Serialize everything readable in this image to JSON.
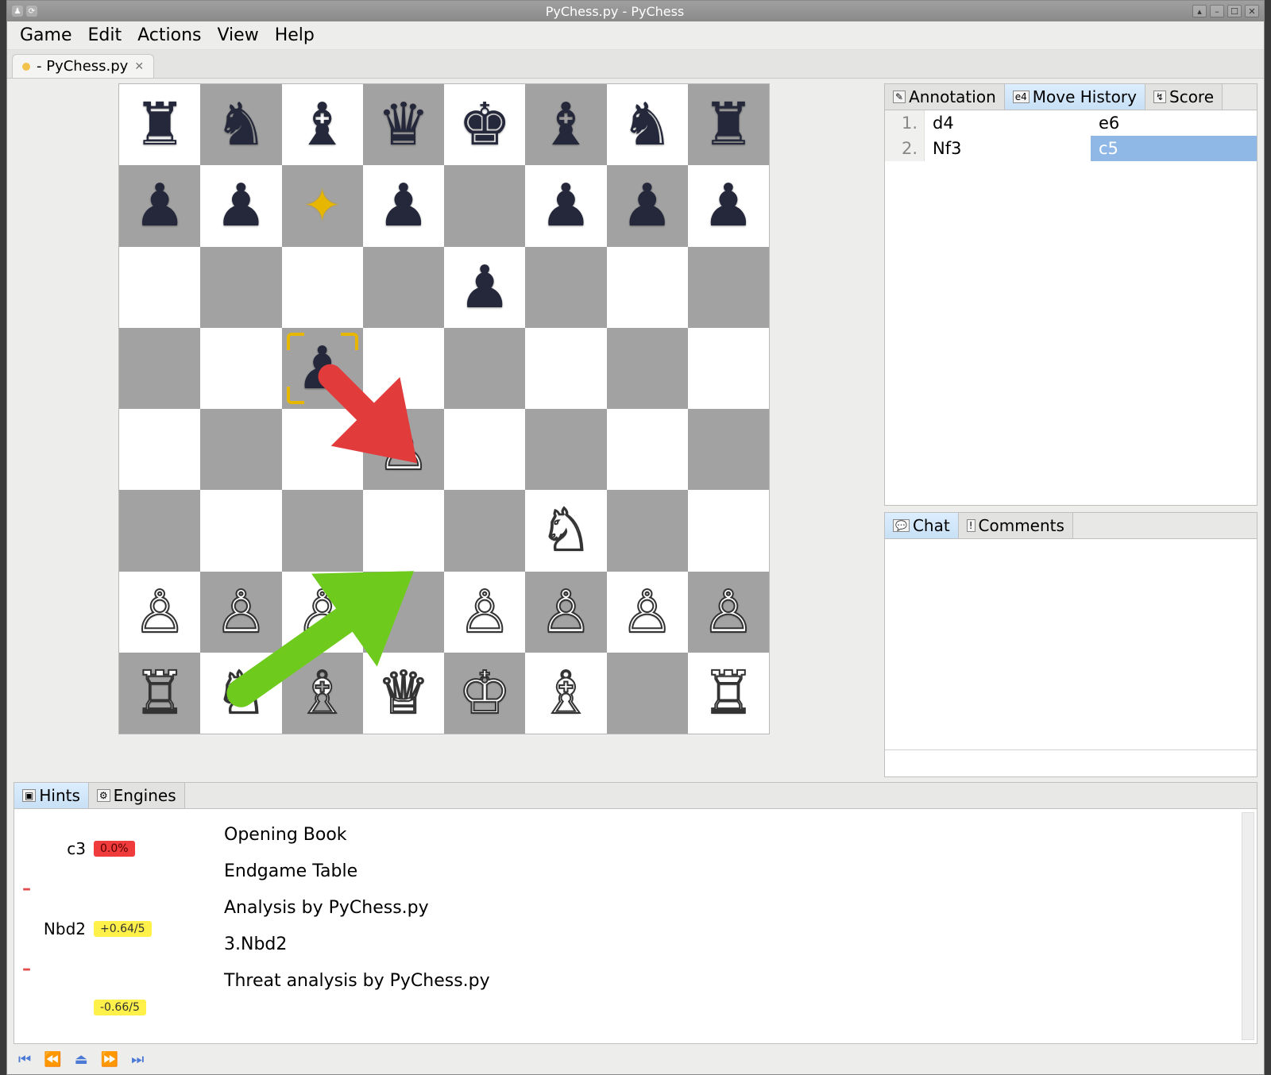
{
  "window_title": "PyChess.py - PyChess",
  "menubar": {
    "items": [
      "Game",
      "Edit",
      "Actions",
      "View",
      "Help"
    ]
  },
  "tab": {
    "label": " - PyChess.py"
  },
  "board": {
    "light_color": "#ffffff",
    "dark_color": "#a2a2a2",
    "position": [
      [
        "bR",
        "bN",
        "bB",
        "bQ",
        "bK",
        "bB",
        "bN",
        "bR"
      ],
      [
        "bP",
        "bP",
        "",
        "bP",
        "",
        "bP",
        "bP",
        "bP"
      ],
      [
        "",
        "",
        "",
        "",
        "bP",
        "",
        "",
        ""
      ],
      [
        "",
        "",
        "bP",
        "",
        "",
        "",
        "",
        ""
      ],
      [
        "",
        "",
        "",
        "wP",
        "",
        "",
        "",
        ""
      ],
      [
        "",
        "",
        "",
        "",
        "",
        "wN",
        "",
        ""
      ],
      [
        "wP",
        "wP",
        "wP",
        "",
        "wP",
        "wP",
        "wP",
        "wP"
      ],
      [
        "wR",
        "wN",
        "wB",
        "wQ",
        "wK",
        "wB",
        "",
        "wR"
      ]
    ],
    "move_origin": "c7",
    "last_move_dest": "c5",
    "suggestion_arrow": {
      "from": "b1",
      "to": "d2",
      "color": "#6ecb1e"
    },
    "threat_arrow": {
      "from": "c5",
      "to": "d4",
      "color": "#e23b3b"
    }
  },
  "right_tabs": {
    "items": [
      "Annotation",
      "Move History",
      "Score"
    ],
    "active": "Move History"
  },
  "move_history": [
    {
      "num": "1.",
      "white": "d4",
      "black": "e6"
    },
    {
      "num": "2.",
      "white": "Nf3",
      "black": "c5",
      "black_selected": true
    }
  ],
  "lower_right_tabs": {
    "items": [
      "Chat",
      "Comments"
    ],
    "active": "Chat"
  },
  "bottom_tabs": {
    "items": [
      "Hints",
      "Engines"
    ],
    "active": "Hints"
  },
  "hints": {
    "left": [
      {
        "move": "c3",
        "badge": "0.0%",
        "badge_style": "red"
      },
      {
        "dash": true
      },
      {
        "move": "Nbd2",
        "badge": "+0.64/5",
        "badge_style": "yel"
      },
      {
        "dash": true
      },
      {
        "move": "",
        "badge": "-0.66/5",
        "badge_style": "yel"
      }
    ],
    "right_lines": [
      "Opening Book",
      "",
      "Endgame Table",
      "Analysis by PyChess.py",
      "3.Nbd2",
      "Threat analysis by PyChess.py"
    ]
  },
  "colors": {
    "accent_blue": "#4a79d6",
    "highlight": "#8fb8e6"
  }
}
